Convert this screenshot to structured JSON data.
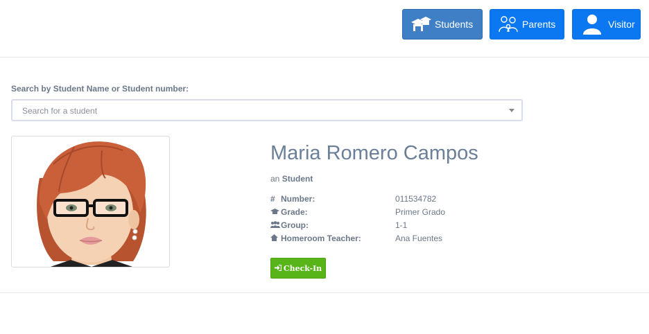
{
  "header": {
    "buttons": [
      {
        "label": "Students",
        "icon": "graduation-icon"
      },
      {
        "label": "Parents",
        "icon": "parents-icon"
      },
      {
        "label": "Visitor",
        "icon": "user-icon"
      }
    ]
  },
  "search": {
    "label": "Search by Student Name or Student number:",
    "placeholder": "Search for a student"
  },
  "student": {
    "name": "Maria Romero Campos",
    "type_prefix": "an",
    "type": "Student",
    "fields": [
      {
        "icon": "hash-icon",
        "key": "Number:",
        "value": "011534782"
      },
      {
        "icon": "graduation-cap-icon",
        "key": "Grade:",
        "value": "Primer Grado"
      },
      {
        "icon": "group-icon",
        "key": "Group:",
        "value": "1-1"
      },
      {
        "icon": "home-icon",
        "key": "Homeroom Teacher:",
        "value": "Ana Fuentes"
      }
    ]
  },
  "checkin": {
    "label": "Check-In",
    "icon": "sign-in-icon"
  },
  "colors": {
    "students_btn": "#3f7fc6",
    "role_btn": "#0b78f2",
    "checkin": "#58b519",
    "name": "#6b7f99"
  }
}
